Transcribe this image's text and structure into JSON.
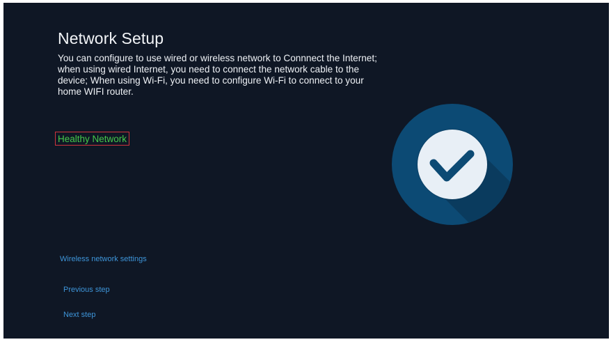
{
  "page": {
    "title": "Network Setup",
    "description": "You can configure to use wired or wireless network to Connnect the Internet; when using wired Internet, you need to connect the network cable to the device; When using Wi-Fi, you need to configure Wi-Fi to connect to your home WIFI router."
  },
  "status": {
    "label": "Healthy Network",
    "color": "#45c94a",
    "focus_border_color": "#d0343c",
    "icon": "checkmark-circle-icon"
  },
  "actions": {
    "wireless_settings": "Wireless network settings",
    "previous_step": "Previous step",
    "next_step": "Next step"
  },
  "colors": {
    "background": "#0f1725",
    "accent": "#3e95d9",
    "badge_circle": "#0c4a74",
    "badge_inner": "#e8eff6"
  }
}
